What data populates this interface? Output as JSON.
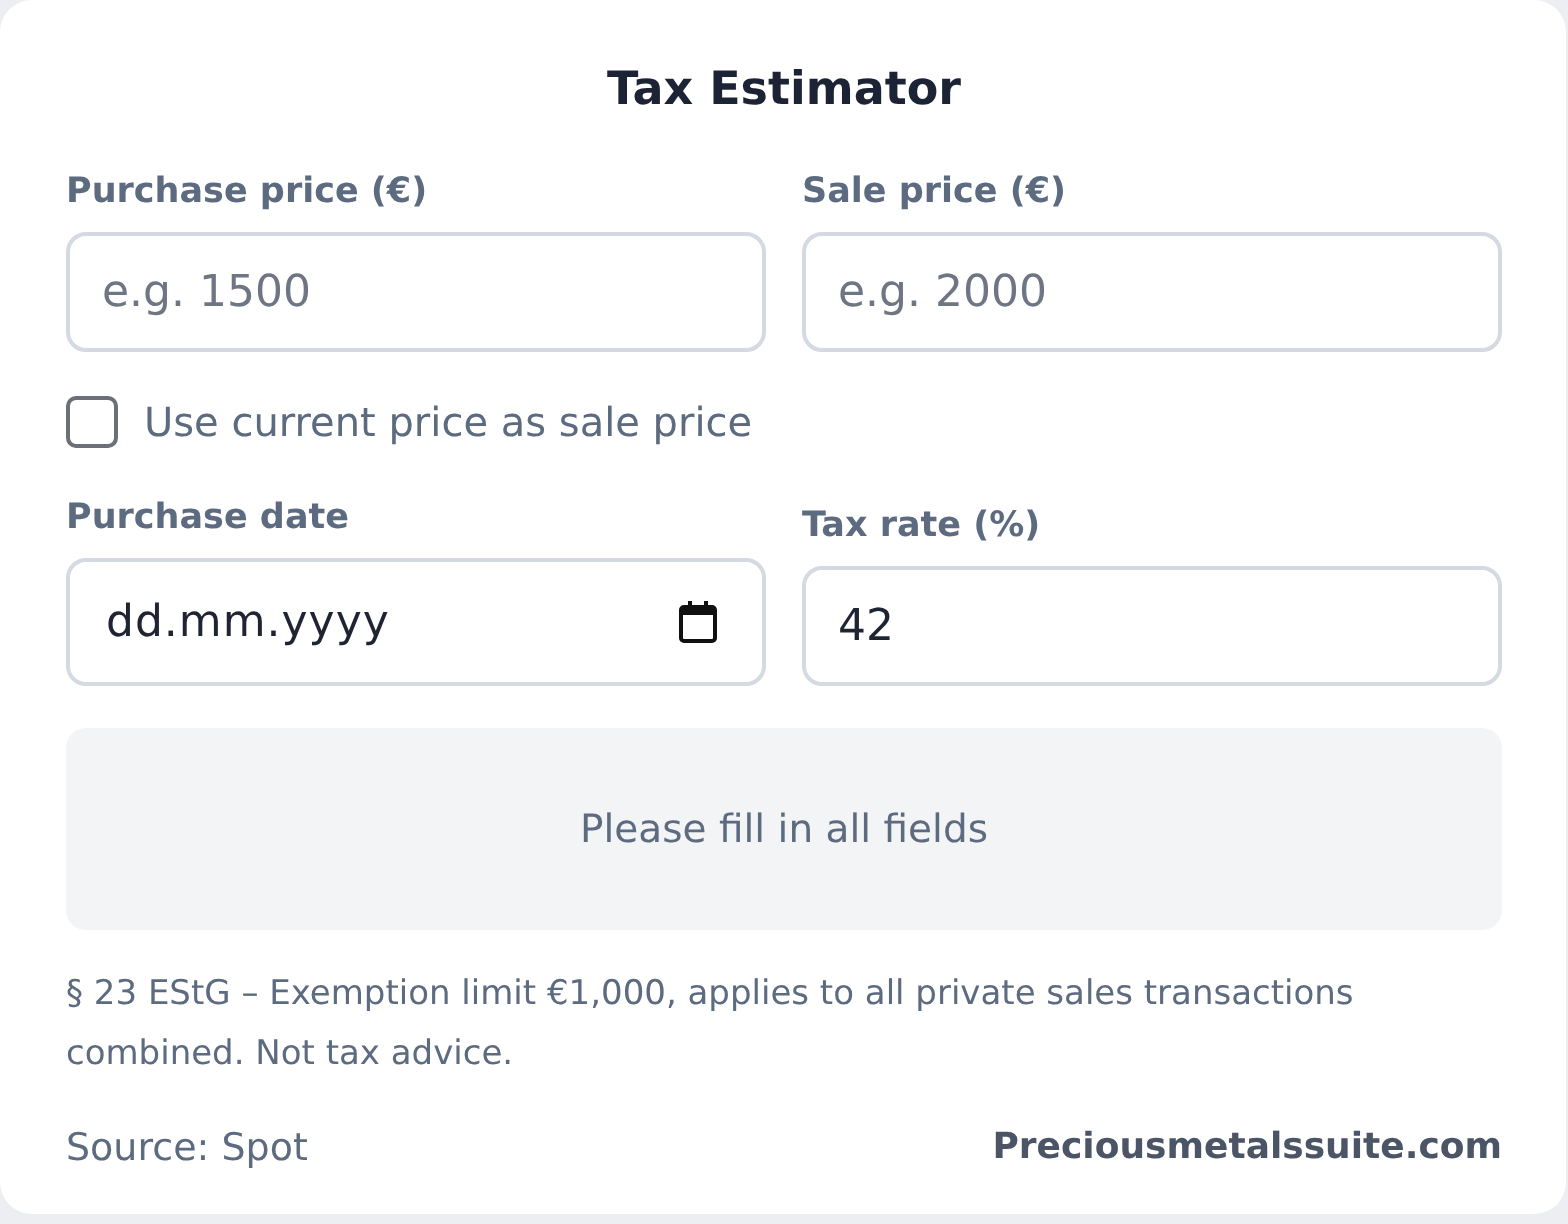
{
  "title": "Tax Estimator",
  "price_fields": [
    {
      "kind": "number",
      "label": "Purchase price (€)",
      "placeholder": "e.g. 1500"
    },
    {
      "kind": "number",
      "label": "Sale price (€)",
      "placeholder": "e.g. 2000"
    }
  ],
  "use_current_price": {
    "label": "Use current price as sale price",
    "checked": false
  },
  "detail_fields": [
    {
      "kind": "date",
      "label": "Purchase date",
      "placeholder": "dd.mm.yyyy"
    },
    {
      "kind": "number",
      "label": "Tax rate (%)",
      "value": "42"
    }
  ],
  "result": {
    "message": "Please fill in all fields"
  },
  "disclaimer": "§ 23 EStG – Exemption limit €1,000, applies to all private sales transactions combined. Not tax advice.",
  "footer": {
    "source": "Source: Spot",
    "site": "Preciousmetalssuite.com"
  }
}
